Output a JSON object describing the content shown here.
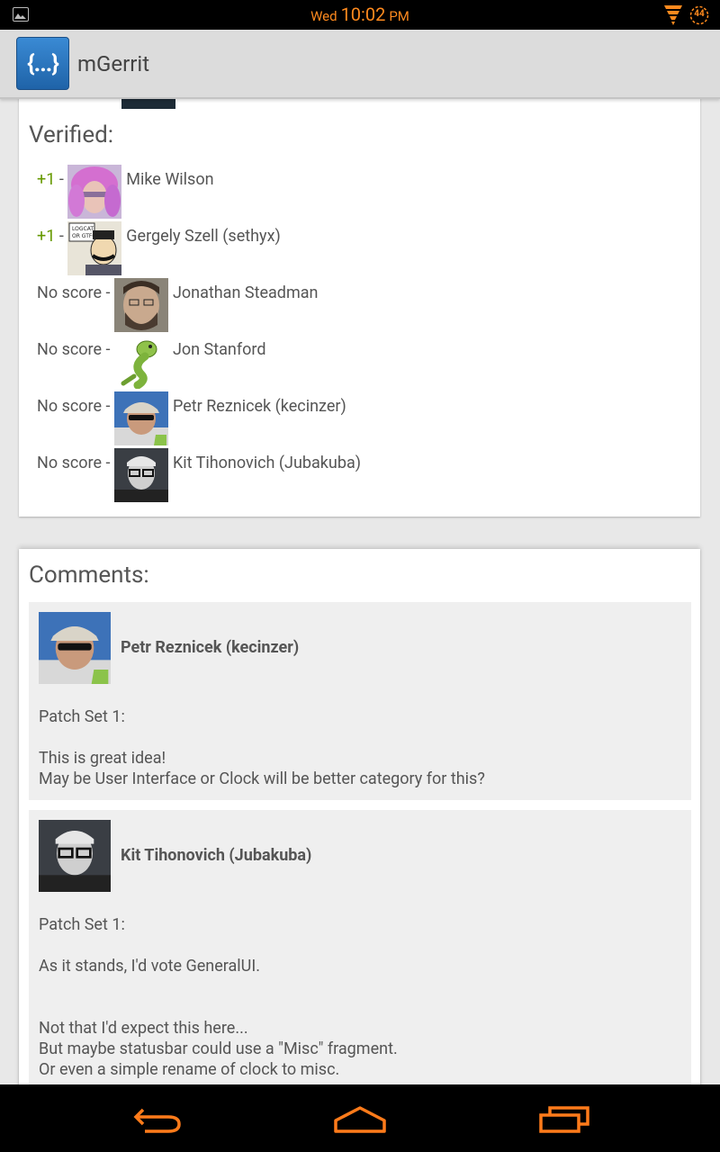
{
  "status_bar": {
    "day": "Wed",
    "time": "10:02",
    "ampm": "PM",
    "battery_level": "44",
    "accent_color": "#ff8a1e",
    "icons": [
      "gallery-icon",
      "notification-stack-icon",
      "battery-icon"
    ]
  },
  "action_bar": {
    "app_icon_text": "{...}",
    "title": "mGerrit"
  },
  "verified": {
    "title": "Verified:",
    "reviewers": [
      {
        "score": "+1",
        "name": "Mike Wilson",
        "avatar": "pink-hair-avatar"
      },
      {
        "score": "+1",
        "name": "Gergely Szell (sethyx)",
        "avatar": "logcat-comic-avatar"
      },
      {
        "score": "No score",
        "name": "Jonathan Steadman",
        "avatar": "bearded-man-avatar"
      },
      {
        "score": "No score",
        "name": "Jon Stanford",
        "avatar": "green-lizard-avatar"
      },
      {
        "score": "No score",
        "name": "Petr Reznicek (kecinzer)",
        "avatar": "cap-sunglasses-avatar"
      },
      {
        "score": "No score",
        "name": "Kit Tihonovich (Jubakuba)",
        "avatar": "glasses-man-avatar"
      }
    ],
    "separator": "-"
  },
  "comments": {
    "title": "Comments:",
    "items": [
      {
        "author": "Petr Reznicek (kecinzer)",
        "patch_set": "Patch Set 1:",
        "body": "This is great idea!\nMay be User Interface or Clock will be better category for this?"
      },
      {
        "author": "Kit Tihonovich (Jubakuba)",
        "patch_set": "Patch Set 1:",
        "body": "As it stands, I'd vote GeneralUI.",
        "body2": "Not that I'd expect this here...\nBut maybe statusbar could use a \"Misc\" fragment.\nOr even a simple rename of clock to misc."
      }
    ]
  },
  "nav_bar": {
    "buttons": [
      "back-icon",
      "home-icon",
      "recent-apps-icon"
    ],
    "color": "#ff7b1a"
  }
}
